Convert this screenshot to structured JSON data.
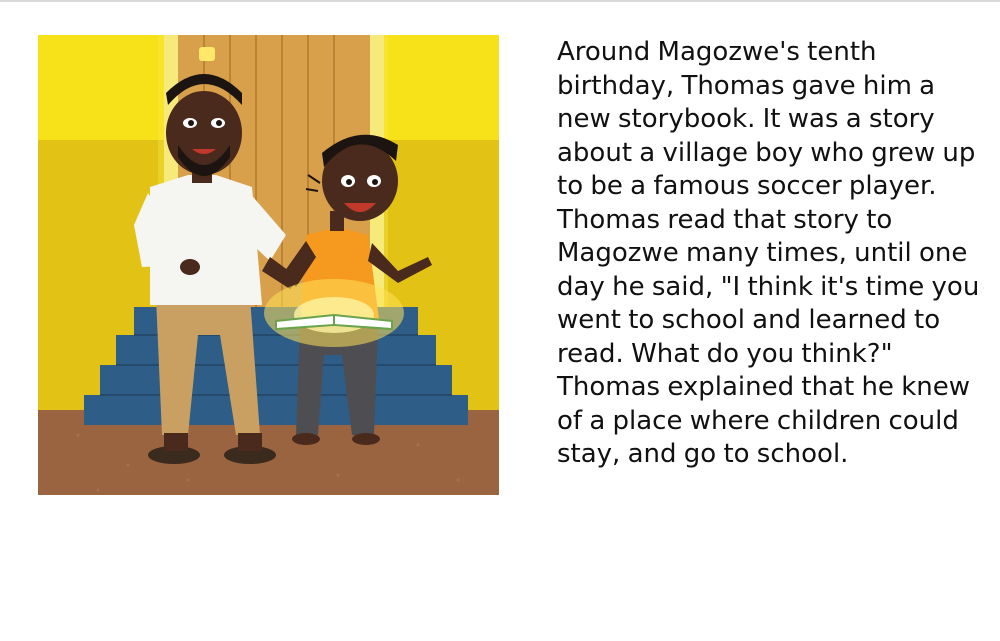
{
  "page": {
    "story_text": "Around Magozwe's tenth birthday, Thomas gave him a new storybook. It was a story about a village boy who grew up to be a famous soccer player. Thomas read that story to Magozwe many times, until one day he said, \"I think it's time you went to school and learned to read. What do you think?\" Thomas explained that he knew of a place where children could stay, and go to school."
  },
  "illustration": {
    "subject": "man-and-boy-reading-book-on-steps",
    "colors": {
      "wall_upper": "#f7e51c",
      "wall_lower": "#e3c614",
      "door": "#d9a14a",
      "steps": "#2f5f8a",
      "floor": "#9c6440",
      "man_shirt": "#f5f5f2",
      "man_trousers": "#c8a060",
      "boy_shirt": "#f59a1e",
      "boy_trousers": "#4f4f52",
      "skin": "#4a2a1c",
      "book_glow": "#ffe25a"
    }
  }
}
